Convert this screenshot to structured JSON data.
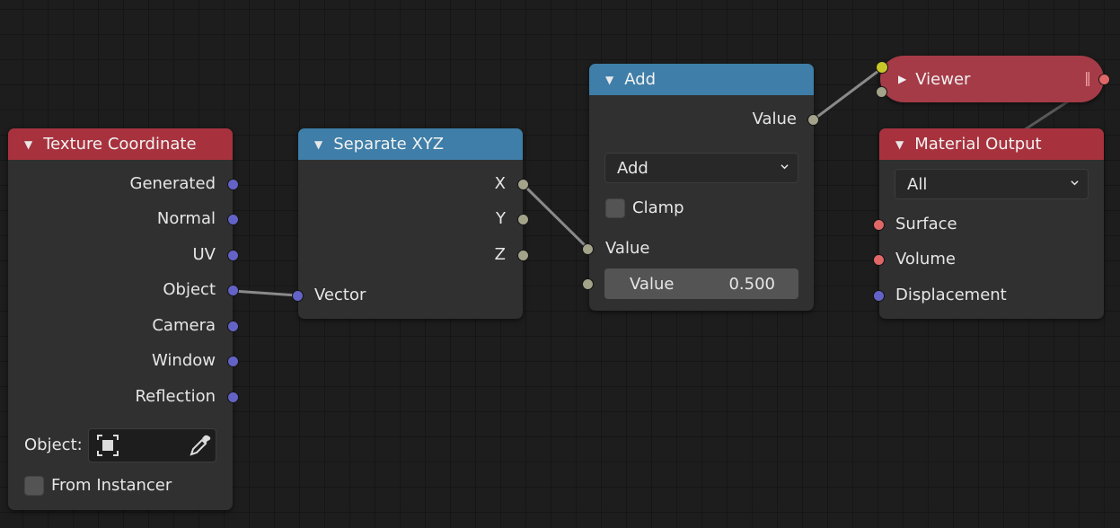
{
  "nodes": {
    "texture_coordinate": {
      "title": "Texture Coordinate",
      "outputs": [
        "Generated",
        "Normal",
        "UV",
        "Object",
        "Camera",
        "Window",
        "Reflection"
      ],
      "object_label": "Object:",
      "from_instancer_label": "From Instancer"
    },
    "separate_xyz": {
      "title": "Separate XYZ",
      "outputs": [
        "X",
        "Y",
        "Z"
      ],
      "input_label": "Vector"
    },
    "add": {
      "title": "Add",
      "output_label": "Value",
      "operation": "Add",
      "clamp_label": "Clamp",
      "input1_label": "Value",
      "input2_label": "Value",
      "input2_value": "0.500"
    },
    "viewer": {
      "title": "Viewer"
    },
    "material_output": {
      "title": "Material Output",
      "target": "All",
      "inputs": [
        "Surface",
        "Volume",
        "Displacement"
      ]
    }
  },
  "colors": {
    "header_red": "#a7323e",
    "header_blue": "#3e7ea8",
    "viewer_body": "#a53b47",
    "socket_vector": "#6363c7",
    "socket_value": "#a3a38a",
    "socket_shader": "#e06767",
    "wire": "#8a8a8a"
  },
  "icons": [
    "collapse-triangle-icon",
    "expand-triangle-icon",
    "chevron-down-icon",
    "object-select-icon",
    "eyedropper-icon",
    "reroute-handle-icon"
  ]
}
